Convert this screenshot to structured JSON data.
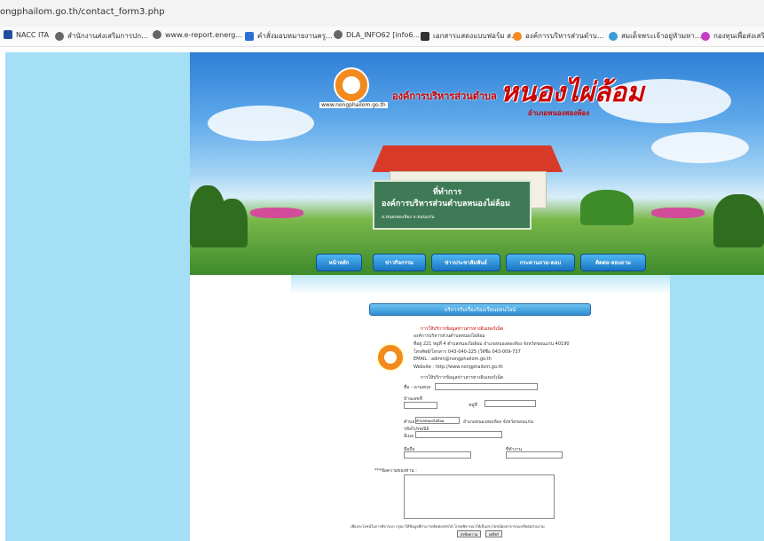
{
  "browser": {
    "url": "ongphailom.go.th/contact_form3.php",
    "bookmarks": [
      {
        "label": "NACC ITA",
        "icon": "nacc-icon",
        "color": "#1f4e9c"
      },
      {
        "label": "สำนักงานส่งเสริมการปก...",
        "icon": "globe-icon",
        "color": "#666"
      },
      {
        "label": "www.e-report.energ...",
        "icon": "globe-icon",
        "color": "#666"
      },
      {
        "label": "คำสั่งมอบหมายงานครู...",
        "icon": "doc-icon",
        "color": "#2b6fd6"
      },
      {
        "label": "DLA_INFO62 [info6...",
        "icon": "globe-icon",
        "color": "#666"
      },
      {
        "label": "เอกสารแสดงแบบฟอร์ม ส...",
        "icon": "doc-icon",
        "color": "#333"
      },
      {
        "label": "องค์การบริหารส่วนตำบ...",
        "icon": "org-icon",
        "color": "#f28a1e"
      },
      {
        "label": "สมเด็จพระเจ้าอยู่หัวมหา...",
        "icon": "globe-icon",
        "color": "#3a9bd8"
      },
      {
        "label": "กองทุนเพื่อส่งเสริม...",
        "icon": "fund-icon",
        "color": "#c43cc4"
      }
    ]
  },
  "banner": {
    "site_url": "www.nongphailom.go.th",
    "org_small": "องค์การบริหารส่วนตำบล",
    "org_big": "หนองไผ่ล้อม",
    "district": "อำเภอหนองสองห้อง",
    "sign_line1": "ที่ทำการ",
    "sign_line2": "องค์การบริหารส่วนตำบลหนองไผ่ล้อม",
    "sign_line3": "อ.หนองสองห้อง จ.ขอนแก่น"
  },
  "nav": [
    {
      "label": "หน้าหลัก"
    },
    {
      "label": "ข่าวกิจกรรม"
    },
    {
      "label": "ข่าวประชาสัมพันธ์"
    },
    {
      "label": "กระดานถาม-ตอบ"
    },
    {
      "label": "ติดต่อ-สอบถาม"
    }
  ],
  "form": {
    "header": "บริการรับเรื่องร้องเรียนออนไลน์",
    "intro_title": "การให้บริการข้อมูลข่าวสารทางอินเทอร์เน็ต",
    "address_lines": [
      "องค์การบริหารส่วนตำบลหนองไผ่ล้อม",
      "ที่อยู่ 221 หมู่ที่ 4 ตำบลหนองไผ่ล้อม อำเภอหนองสองห้อง จังหวัดขอนแก่น 40190",
      "โทรศัพท์/โทรสาร 043-040-225 (ใช้ชื่อ 043-009-737",
      "EMAIL : admin@nongphailom.go.th",
      "Website : http://www.nongphailom.go.th"
    ],
    "form_title": "การให้บริการข้อมูลข่าวสารทางอินเทอร์เน็ต",
    "fields": {
      "name_label": "ชื่อ - นามสกุล",
      "house_label": "บ้านเลขที่",
      "moo_label": "หมู่ที่",
      "tambon_label": "ตำบล",
      "tambon_value": "ตำบลหนองไผ่ล้อม",
      "amphoe_text": "อำเภอหนองสองห้อง จังหวัดขอนแก่น",
      "postcode_label": "รหัสไปรษณีย์",
      "id_label": "อีเมล",
      "phone_label": "มือถือ",
      "work_label": "ที่ทำงาน",
      "message_label": "***ข้อความของท่าน :"
    },
    "note": "เพื่อประโยชน์ในการพิจารณา กรุณาให้ข้อมูลที่สามารถติดต่อกลับได้ โปรดพิจารณาให้เป็นประโยชน์ต่อสาธารณะหรือต่อส่วนรวม",
    "submit_label": "ส่งข้อความ",
    "reset_label": "เคลียร์"
  }
}
